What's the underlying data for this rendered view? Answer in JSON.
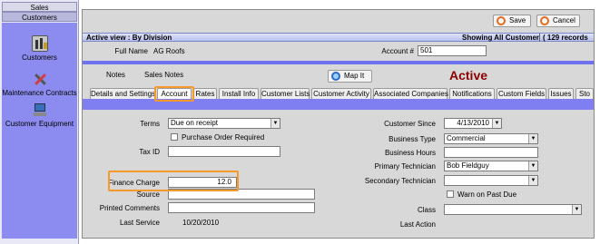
{
  "sidebar": {
    "sales": "Sales",
    "customers": "Customers",
    "items": [
      {
        "label": "Customers",
        "icon": "factory-icon"
      },
      {
        "label": "Maintenance Contracts",
        "icon": "tools-icon"
      },
      {
        "label": "Customer Equipment",
        "icon": "equipment-icon"
      }
    ]
  },
  "toolbar": {
    "save": "Save",
    "cancel": "Cancel"
  },
  "view": {
    "active_view": "Active view : By Division",
    "showing": "Showing All Customer",
    "records": "( 129 records"
  },
  "header": {
    "full_name_label": "Full Name",
    "full_name": "AG Roofs",
    "account_label": "Account #",
    "account": "501"
  },
  "notes": {
    "notes": "Notes",
    "sales_notes": "Sales Notes",
    "map_it": "Map It",
    "status": "Active"
  },
  "tabs": [
    "Details and Settings",
    "Account",
    "Rates",
    "Install Info",
    "Customer Lists",
    "Customer Activity",
    "Associated Companies",
    "Notifications",
    "Custom Fields",
    "Issues",
    "Sto"
  ],
  "form": {
    "terms_label": "Terms",
    "terms": "Due on receipt",
    "po_label": "Purchase Order Required",
    "taxid_label": "Tax ID",
    "taxid": "",
    "finance_label": "Finance Charge",
    "finance": "12.0",
    "source_label": "Source",
    "source": "",
    "printed_label": "Printed Comments",
    "printed": "",
    "lastservice_label": "Last Service",
    "lastservice": "10/20/2010",
    "since_label": "Customer Since",
    "since": "4/13/2010",
    "btype_label": "Business Type",
    "btype": "Commercial",
    "bhours_label": "Business Hours",
    "bhours": "",
    "primary_label": "Primary Technician",
    "primary": "Bob Fieldguy",
    "secondary_label": "Secondary Technician",
    "secondary": "",
    "warn_label": "Warn on Past Due",
    "class_label": "Class",
    "class": "",
    "lastaction_label": "Last Action"
  },
  "colors": {
    "accent": "#7f7ff2",
    "highlight": "#f59a2a",
    "status": "#8b0000"
  }
}
